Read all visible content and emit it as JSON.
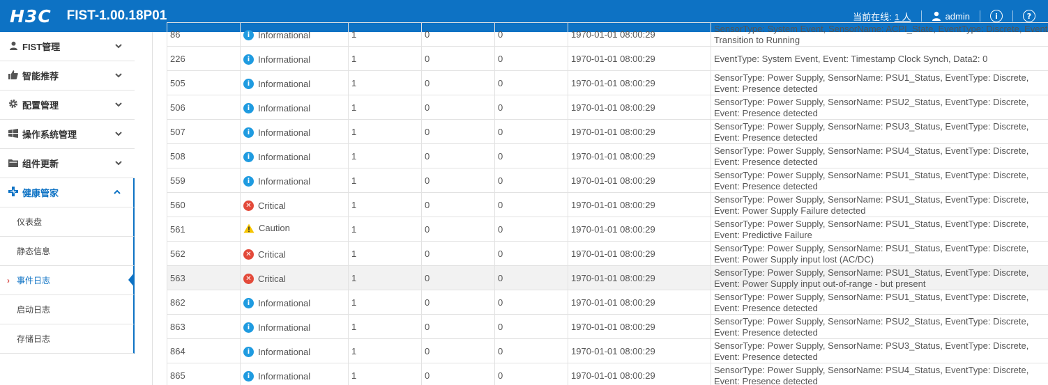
{
  "header": {
    "logo": "H3C",
    "title": "FIST-1.00.18P01",
    "online_label": "当前在线:",
    "online_count": "1 人",
    "user": "admin",
    "info_glyph": "i",
    "help_glyph": "?"
  },
  "sidebar": {
    "items": [
      {
        "label": "FIST管理",
        "icon": "user-icon"
      },
      {
        "label": "智能推荐",
        "icon": "thumbs-up-icon"
      },
      {
        "label": "配置管理",
        "icon": "gear-icon"
      },
      {
        "label": "操作系统管理",
        "icon": "windows-icon"
      },
      {
        "label": "组件更新",
        "icon": "folder-icon"
      },
      {
        "label": "健康管家",
        "icon": "medical-cross-icon"
      }
    ],
    "sub_items": [
      {
        "label": "仪表盘"
      },
      {
        "label": "静态信息"
      },
      {
        "label": "事件日志"
      },
      {
        "label": "启动日志"
      },
      {
        "label": "存储日志"
      }
    ],
    "current_sub_marker": "›"
  },
  "table": {
    "rows": [
      {
        "id": "86",
        "severity": "Informational",
        "level": "info",
        "c1": "1",
        "c2": "0",
        "c3": "0",
        "time": "1970-01-01 08:00:29",
        "desc": "SensorType: System Event, SensorName: ACPI_State, EventType: Discrete, Event: Transition to Running"
      },
      {
        "id": "226",
        "severity": "Informational",
        "level": "info",
        "c1": "1",
        "c2": "0",
        "c3": "0",
        "time": "1970-01-01 08:00:29",
        "desc": "EventType: System Event, Event: Timestamp Clock Synch, Data2: 0"
      },
      {
        "id": "505",
        "severity": "Informational",
        "level": "info",
        "c1": "1",
        "c2": "0",
        "c3": "0",
        "time": "1970-01-01 08:00:29",
        "desc": "SensorType: Power Supply, SensorName: PSU1_Status, EventType: Discrete, Event: Presence detected"
      },
      {
        "id": "506",
        "severity": "Informational",
        "level": "info",
        "c1": "1",
        "c2": "0",
        "c3": "0",
        "time": "1970-01-01 08:00:29",
        "desc": "SensorType: Power Supply, SensorName: PSU2_Status, EventType: Discrete, Event: Presence detected"
      },
      {
        "id": "507",
        "severity": "Informational",
        "level": "info",
        "c1": "1",
        "c2": "0",
        "c3": "0",
        "time": "1970-01-01 08:00:29",
        "desc": "SensorType: Power Supply, SensorName: PSU3_Status, EventType: Discrete, Event: Presence detected"
      },
      {
        "id": "508",
        "severity": "Informational",
        "level": "info",
        "c1": "1",
        "c2": "0",
        "c3": "0",
        "time": "1970-01-01 08:00:29",
        "desc": "SensorType: Power Supply, SensorName: PSU4_Status, EventType: Discrete, Event: Presence detected"
      },
      {
        "id": "559",
        "severity": "Informational",
        "level": "info",
        "c1": "1",
        "c2": "0",
        "c3": "0",
        "time": "1970-01-01 08:00:29",
        "desc": "SensorType: Power Supply, SensorName: PSU1_Status, EventType: Discrete, Event: Presence detected"
      },
      {
        "id": "560",
        "severity": "Critical",
        "level": "crit",
        "c1": "1",
        "c2": "0",
        "c3": "0",
        "time": "1970-01-01 08:00:29",
        "desc": "SensorType: Power Supply, SensorName: PSU1_Status, EventType: Discrete, Event: Power Supply Failure detected"
      },
      {
        "id": "561",
        "severity": "Caution",
        "level": "warn",
        "c1": "1",
        "c2": "0",
        "c3": "0",
        "time": "1970-01-01 08:00:29",
        "desc": "SensorType: Power Supply, SensorName: PSU1_Status, EventType: Discrete, Event: Predictive Failure"
      },
      {
        "id": "562",
        "severity": "Critical",
        "level": "crit",
        "c1": "1",
        "c2": "0",
        "c3": "0",
        "time": "1970-01-01 08:00:29",
        "desc": "SensorType: Power Supply, SensorName: PSU1_Status, EventType: Discrete, Event: Power Supply input lost (AC/DC)"
      },
      {
        "id": "563",
        "severity": "Critical",
        "level": "crit",
        "c1": "1",
        "c2": "0",
        "c3": "0",
        "time": "1970-01-01 08:00:29",
        "desc": "SensorType: Power Supply, SensorName: PSU1_Status, EventType: Discrete, Event: Power Supply input out-of-range - but present"
      },
      {
        "id": "862",
        "severity": "Informational",
        "level": "info",
        "c1": "1",
        "c2": "0",
        "c3": "0",
        "time": "1970-01-01 08:00:29",
        "desc": "SensorType: Power Supply, SensorName: PSU1_Status, EventType: Discrete, Event: Presence detected"
      },
      {
        "id": "863",
        "severity": "Informational",
        "level": "info",
        "c1": "1",
        "c2": "0",
        "c3": "0",
        "time": "1970-01-01 08:00:29",
        "desc": "SensorType: Power Supply, SensorName: PSU2_Status, EventType: Discrete, Event: Presence detected"
      },
      {
        "id": "864",
        "severity": "Informational",
        "level": "info",
        "c1": "1",
        "c2": "0",
        "c3": "0",
        "time": "1970-01-01 08:00:29",
        "desc": "SensorType: Power Supply, SensorName: PSU3_Status, EventType: Discrete, Event: Presence detected"
      },
      {
        "id": "865",
        "severity": "Informational",
        "level": "info",
        "c1": "1",
        "c2": "0",
        "c3": "0",
        "time": "1970-01-01 08:00:29",
        "desc": "SensorType: Power Supply, SensorName: PSU4_Status, EventType: Discrete, Event: Presence detected"
      }
    ]
  },
  "colors": {
    "brand": "#0d72c4",
    "info": "#1f9be0",
    "critical": "#e34a3a",
    "caution": "#f5c400"
  }
}
